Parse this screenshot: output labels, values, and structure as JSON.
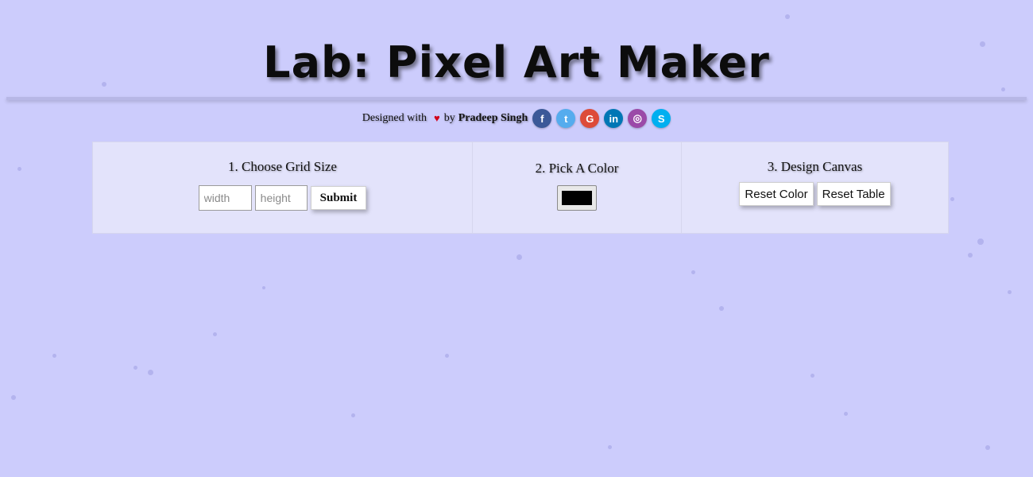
{
  "page": {
    "title": "Lab: Pixel Art Maker"
  },
  "credits": {
    "prefix": "Designed with",
    "heart": "♥",
    "by": "by",
    "author": "Pradeep Singh",
    "social": [
      {
        "icon": "facebook-icon",
        "glyph": "f",
        "color": "#3b5998"
      },
      {
        "icon": "twitter-icon",
        "glyph": "t",
        "color": "#55acee"
      },
      {
        "icon": "google-icon",
        "glyph": "G",
        "color": "#dd4b39"
      },
      {
        "icon": "linkedin-icon",
        "glyph": "in",
        "color": "#0077b5"
      },
      {
        "icon": "instagram-icon",
        "glyph": "◎",
        "color": "#9b4aa8"
      },
      {
        "icon": "skype-icon",
        "glyph": "S",
        "color": "#00aff0"
      }
    ]
  },
  "grid_size": {
    "heading": "1. Choose Grid Size",
    "width_placeholder": "width",
    "width_value": "",
    "height_placeholder": "height",
    "height_value": "",
    "submit_label": "Submit"
  },
  "color": {
    "heading": "2. Pick A Color",
    "value": "#000000"
  },
  "canvas": {
    "heading": "3. Design Canvas",
    "reset_color_label": "Reset Color",
    "reset_table_label": "Reset Table"
  }
}
